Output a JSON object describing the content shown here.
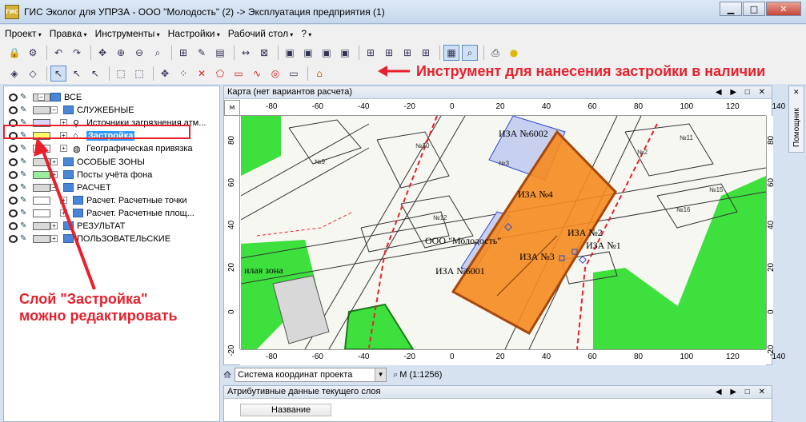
{
  "window": {
    "title": "ГИС Эколог для УПРЗА - ООО \"Молодость\" (2) -> Эксплуатация предприятия (1)"
  },
  "menu": [
    "Проект",
    "Правка",
    "Инструменты",
    "Настройки",
    "Рабочий стол",
    "?"
  ],
  "annotations": {
    "tool": "Инструмент для нанесения застройки в наличии",
    "layer_line1": "Слой \"Застройка\"",
    "layer_line2": "можно редактировать",
    "color": "#e8202c"
  },
  "layers": [
    {
      "label": "ВСЕ",
      "color": "#d9d9d9"
    },
    {
      "label": "СЛУЖЕБНЫЕ",
      "color": "#d9d9d9"
    },
    {
      "label": "Источники загрязнения атм...",
      "color": "#d9d9ff"
    },
    {
      "label": "Застройка",
      "color": "#ffff66",
      "selected": true
    },
    {
      "label": "Географическая привязка",
      "color": "#ffffff"
    },
    {
      "label": "ОСОБЫЕ ЗОНЫ",
      "color": "#d9d9d9"
    },
    {
      "label": "Посты учёта фона",
      "color": "#99ee99"
    },
    {
      "label": "РАСЧЕТ",
      "color": "#d9d9d9"
    },
    {
      "label": "Расчет. Расчетные точки",
      "color": "#ffffff"
    },
    {
      "label": "Расчет. Расчетные площ...",
      "color": "#ffffff"
    },
    {
      "label": "РЕЗУЛЬТАТ",
      "color": "#d9d9d9"
    },
    {
      "label": "ПОЛЬЗОВАТЕЛЬСКИЕ",
      "color": "#d9d9d9"
    }
  ],
  "map": {
    "header": "Карта (нет вариантов расчета)",
    "corner_label": "м",
    "x_ticks": [
      "-80",
      "-60",
      "-40",
      "-20",
      "0",
      "20",
      "40",
      "60",
      "80",
      "100",
      "120",
      "140"
    ],
    "y_ticks": [
      "80",
      "60",
      "40",
      "20",
      "0",
      "-20"
    ],
    "labels": {
      "iza6002": "ИЗА №6002",
      "iza4": "ИЗА №4",
      "iza2": "ИЗА №2",
      "iza1": "ИЗА №1",
      "iza3": "ИЗА №3",
      "iza6001": "ИЗА №6001",
      "company": "ООО \"Молодость\"",
      "zone": "илая зона",
      "n9": "№9",
      "n10": "№10",
      "n15": "№15",
      "n2": "№2",
      "n3": "№3",
      "n11": "№11",
      "n16": "№16",
      "n12": "№12"
    },
    "colors": {
      "building": "#f5891f",
      "green": "#3de03d",
      "red_line": "#e8202c",
      "source_blue": "#c8d0f0"
    }
  },
  "coord_system": {
    "value": "Система координат проекта",
    "zoom": "М (1:1256)"
  },
  "attributes": {
    "header": "Атрибутивные данные текущего слоя",
    "column": "Название"
  },
  "helper": {
    "label": "Помощник"
  }
}
